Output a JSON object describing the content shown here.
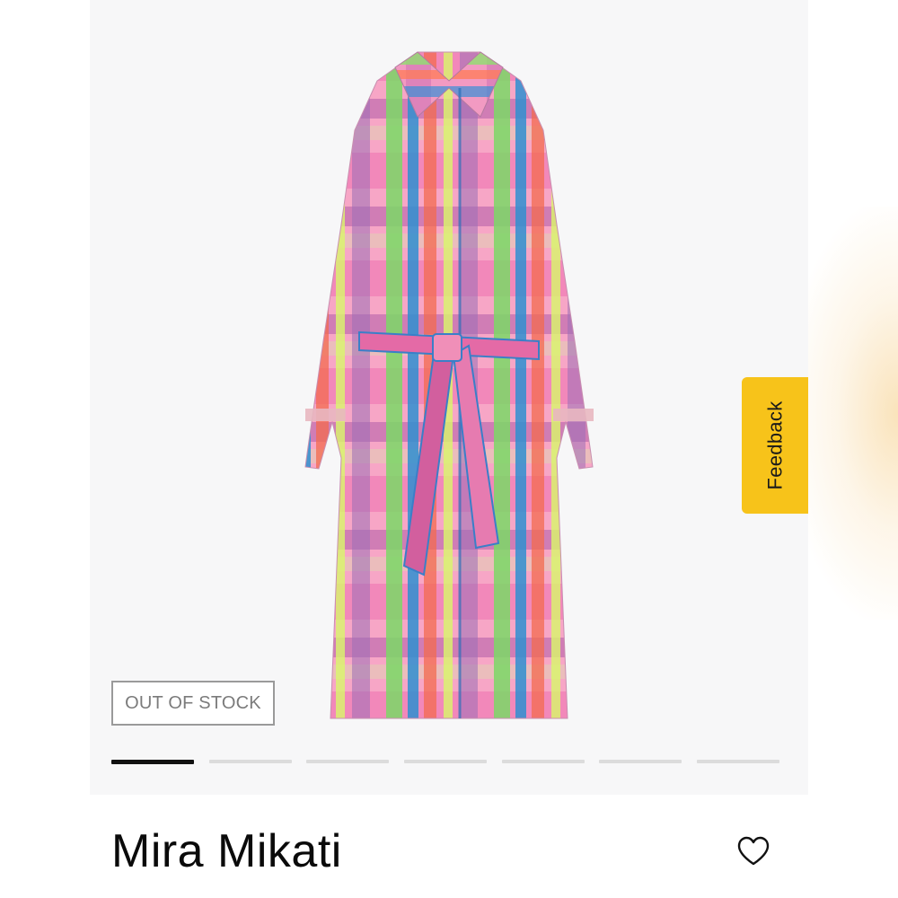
{
  "product": {
    "brand": "Mira Mikati",
    "stock_status": "OUT OF STOCK",
    "image_description_icon": "plaid-trench-coat-image"
  },
  "carousel": {
    "total_slides": 7,
    "active_index": 0
  },
  "feedback": {
    "label": "Feedback",
    "color": "#f7c31a"
  },
  "wishlist": {
    "icon": "heart-outline-icon"
  },
  "colors": {
    "gallery_bg": "#f7f7f8",
    "badge_border": "#9a9a9a",
    "active_indicator": "#111111",
    "inactive_indicator": "#dcdcdc"
  }
}
